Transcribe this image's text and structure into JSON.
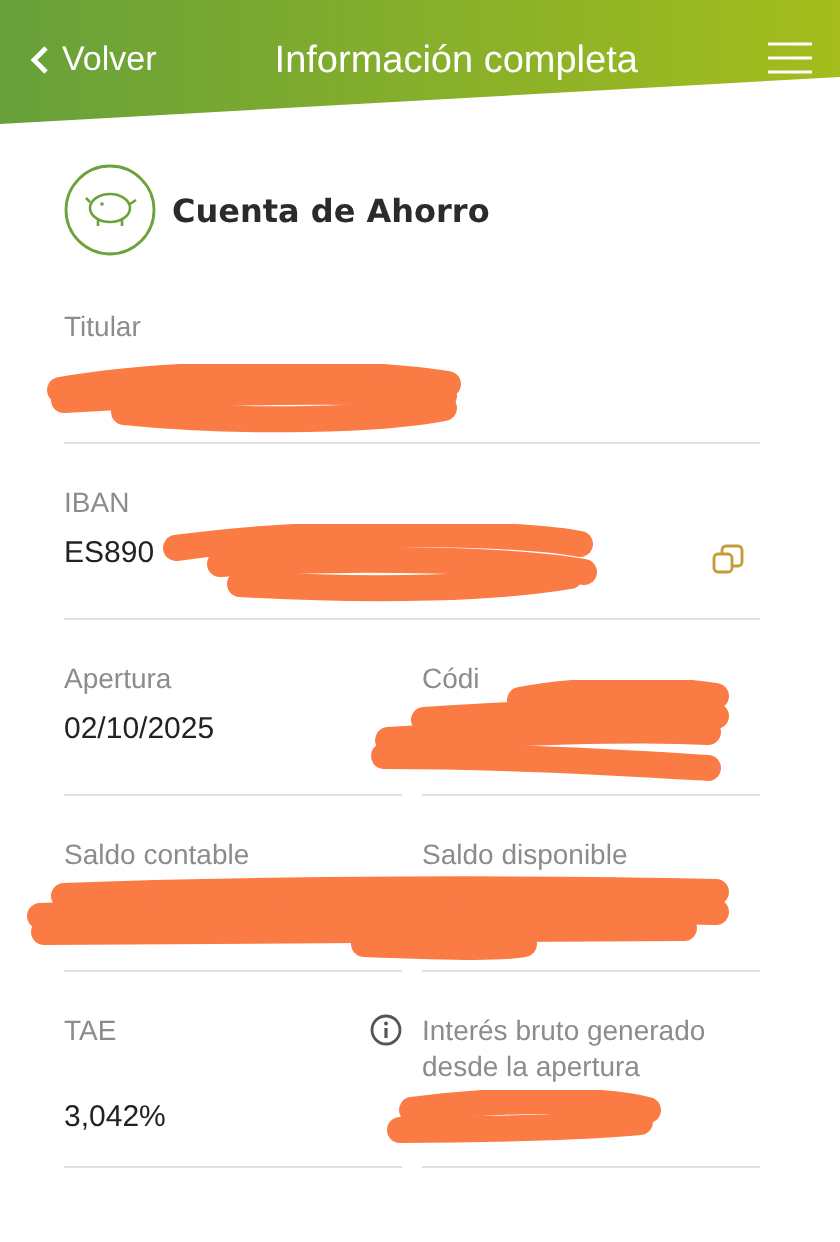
{
  "header": {
    "back": "Volver",
    "title": "Información completa"
  },
  "account": {
    "name": "Cuenta de Ahorro"
  },
  "fields": [
    {
      "kind": "full",
      "label": "Titular"
    },
    {
      "kind": "copy",
      "label": "IBAN",
      "value": "ES890"
    }
  ],
  "rows": [
    [
      {
        "label": "Apertura",
        "value": "02/10/2025"
      },
      {
        "label": "Códi"
      }
    ],
    [
      {
        "label": "Saldo contable"
      },
      {
        "label": "Saldo disponible"
      }
    ],
    [
      {
        "label": "TAE",
        "value": "3,042%",
        "info": true
      },
      {
        "label": "Interés bruto generado desde la apertura"
      }
    ]
  ]
}
